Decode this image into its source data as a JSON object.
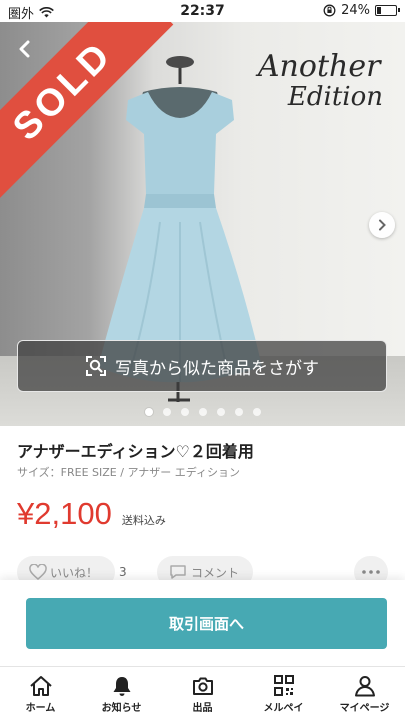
{
  "status_bar": {
    "carrier": "圏外",
    "time": "22:37",
    "battery": "24%",
    "battery_level": 0.24
  },
  "photo": {
    "sold_label": "SOLD",
    "brand_logo_line1": "Another",
    "brand_logo_line2": "Edition",
    "photo_search_label": "写真から似た商品をさがす",
    "image_count": 7,
    "active_index": 0
  },
  "item": {
    "title": "アナザーエディション♡２回着用",
    "meta": "サイズ：FREE SIZE / アナザー エディション",
    "price": "¥2,100",
    "shipping": "送料込み"
  },
  "actions": {
    "like_label": "いいね！",
    "like_count": "3",
    "comment_label": "コメント"
  },
  "cta": {
    "trade_button": "取引画面へ"
  },
  "tabbar": {
    "items": [
      {
        "label": "ホーム",
        "icon": "home-icon"
      },
      {
        "label": "お知らせ",
        "icon": "bell-icon"
      },
      {
        "label": "出品",
        "icon": "camera-icon"
      },
      {
        "label": "メルペイ",
        "icon": "qr-code-icon"
      },
      {
        "label": "マイページ",
        "icon": "person-icon"
      }
    ]
  },
  "colors": {
    "sold_band": "#e04f3f",
    "price": "#e03a2f",
    "primary_button": "#47a9b3"
  }
}
